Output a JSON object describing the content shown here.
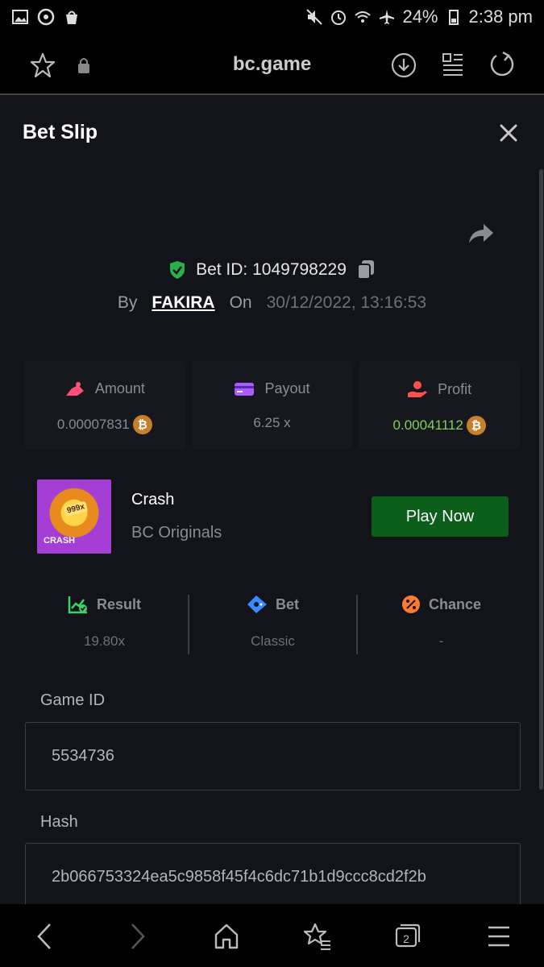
{
  "status_bar": {
    "battery": "24%",
    "time": "2:38 pm",
    "icons": [
      "image-icon",
      "edge-icon",
      "bag-icon",
      "mute-icon",
      "alarm-icon",
      "wifi-icon",
      "airplane-icon",
      "battery-icon"
    ]
  },
  "browser": {
    "url": "bc.game",
    "tab_count": "2"
  },
  "modal": {
    "title": "Bet Slip",
    "bet_id": "Bet ID: 1049798229",
    "by_label": "By",
    "user": "FAKIRA",
    "on_label": "On",
    "date": "30/12/2022, 13:16:53"
  },
  "stats": {
    "amount": {
      "label": "Amount",
      "value": "0.00007831"
    },
    "payout": {
      "label": "Payout",
      "value": "6.25 x"
    },
    "profit": {
      "label": "Profit",
      "value": "0.00041112"
    },
    "btc_symbol": "₿"
  },
  "game": {
    "name": "Crash",
    "provider": "BC Originals",
    "thumb_badge": "999x",
    "thumb_label": "CRASH",
    "play_label": "Play Now"
  },
  "info": {
    "result": {
      "label": "Result",
      "value": "19.80x"
    },
    "bet": {
      "label": "Bet",
      "value": "Classic"
    },
    "chance": {
      "label": "Chance",
      "value": "-"
    }
  },
  "fields": {
    "game_id_label": "Game ID",
    "game_id_value": "5534736",
    "hash_label": "Hash",
    "hash_value": "2b066753324ea5c9858f45f4c6dc71b1d9ccc8cd2f2b"
  },
  "colors": {
    "modal_bg": "#131419",
    "play_button": "#0c5f1a",
    "profit_green": "#7ed05a",
    "btc_orange": "#c77f2a"
  }
}
